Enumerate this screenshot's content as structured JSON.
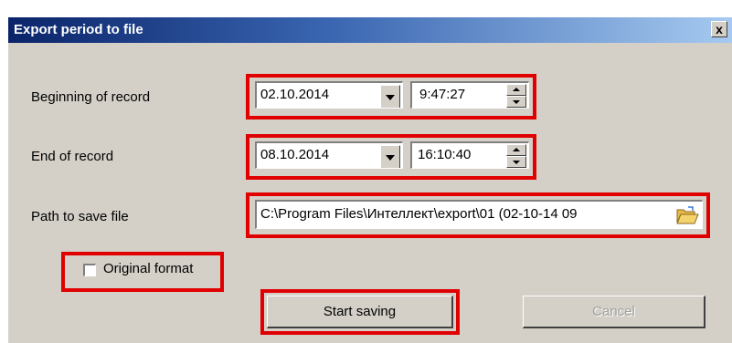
{
  "window": {
    "title": "Export period to file",
    "close_label": "x"
  },
  "beginning": {
    "label": "Beginning of record",
    "date": "02.10.2014",
    "time": "9:47:27"
  },
  "end": {
    "label": "End of record",
    "date": "08.10.2014",
    "time": "16:10:40"
  },
  "path": {
    "label": "Path to save file",
    "value": "C:\\Program Files\\Интеллект\\export\\01  (02-10-14 09",
    "browse_icon": "folder-open-icon"
  },
  "original_format": {
    "label": "Original format",
    "checked": false
  },
  "buttons": {
    "start": "Start saving",
    "cancel": "Cancel"
  },
  "colors": {
    "highlight": "#e00000",
    "dialog_bg": "#d4d0c8",
    "title_start": "#0a246a",
    "title_end": "#a6caf0"
  }
}
